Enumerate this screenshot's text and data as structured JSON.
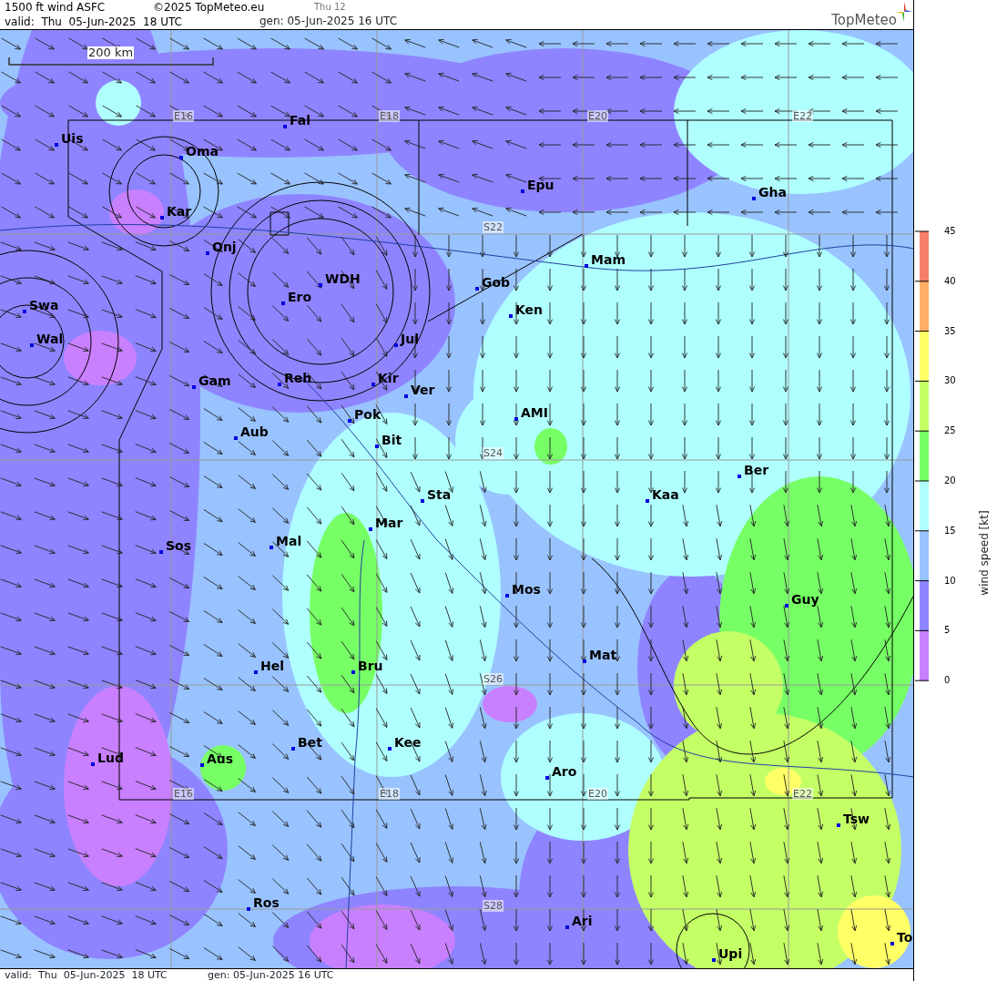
{
  "header": {
    "title": "1500 ft wind ASFC",
    "copyright": "©2025 TopMeteo.eu",
    "run_label": "Thu 12",
    "valid": "valid:  Thu  05-Jun-2025  18 UTC",
    "generated": "gen: 05-Jun-2025 16 UTC",
    "logo": "TopMeteo"
  },
  "map": {
    "scale_label": "200 km",
    "grid_labels": [
      "E16",
      "E18",
      "E20",
      "E22",
      "S22",
      "S24",
      "S26",
      "S28",
      "E16",
      "E18",
      "E20",
      "E22"
    ],
    "places": [
      {
        "name": "Uis"
      },
      {
        "name": "Oma"
      },
      {
        "name": "Fal"
      },
      {
        "name": "Kar"
      },
      {
        "name": "Epu"
      },
      {
        "name": "Gha"
      },
      {
        "name": "Onj"
      },
      {
        "name": "Mam"
      },
      {
        "name": "Gob"
      },
      {
        "name": "WDH"
      },
      {
        "name": "Ero"
      },
      {
        "name": "Swa"
      },
      {
        "name": "Ken"
      },
      {
        "name": "Wal"
      },
      {
        "name": "Jul"
      },
      {
        "name": "Gam"
      },
      {
        "name": "Reh"
      },
      {
        "name": "Kir"
      },
      {
        "name": "Ver"
      },
      {
        "name": "AMI"
      },
      {
        "name": "Pok"
      },
      {
        "name": "Aub"
      },
      {
        "name": "Bit"
      },
      {
        "name": "Ber"
      },
      {
        "name": "Kaa"
      },
      {
        "name": "Sta"
      },
      {
        "name": "Mar"
      },
      {
        "name": "Mal"
      },
      {
        "name": "Sos"
      },
      {
        "name": "Mos"
      },
      {
        "name": "Guy"
      },
      {
        "name": "Mat"
      },
      {
        "name": "Hel"
      },
      {
        "name": "Bru"
      },
      {
        "name": "Bet"
      },
      {
        "name": "Kee"
      },
      {
        "name": "Aus"
      },
      {
        "name": "Lud"
      },
      {
        "name": "Aro"
      },
      {
        "name": "Tsw"
      },
      {
        "name": "Ros"
      },
      {
        "name": "Ari"
      },
      {
        "name": "To"
      },
      {
        "name": "Upi"
      }
    ]
  },
  "legend": {
    "label": "wind speed [kt]",
    "ticks": [
      "45",
      "40",
      "35",
      "30",
      "25",
      "20",
      "15",
      "10",
      "5",
      "0"
    ],
    "bands": [
      {
        "color": "#f57f6a"
      },
      {
        "color": "#ffb066"
      },
      {
        "color": "#ffff66"
      },
      {
        "color": "#c4ff66"
      },
      {
        "color": "#77ff66"
      },
      {
        "color": "#b0ffff"
      },
      {
        "color": "#99c3ff"
      },
      {
        "color": "#8f84ff"
      },
      {
        "color": "#c880ff"
      }
    ]
  },
  "footer": {
    "valid": "valid:  Thu  05-Jun-2025  18 UTC",
    "generated": "gen: 05-Jun-2025 16 UTC"
  }
}
